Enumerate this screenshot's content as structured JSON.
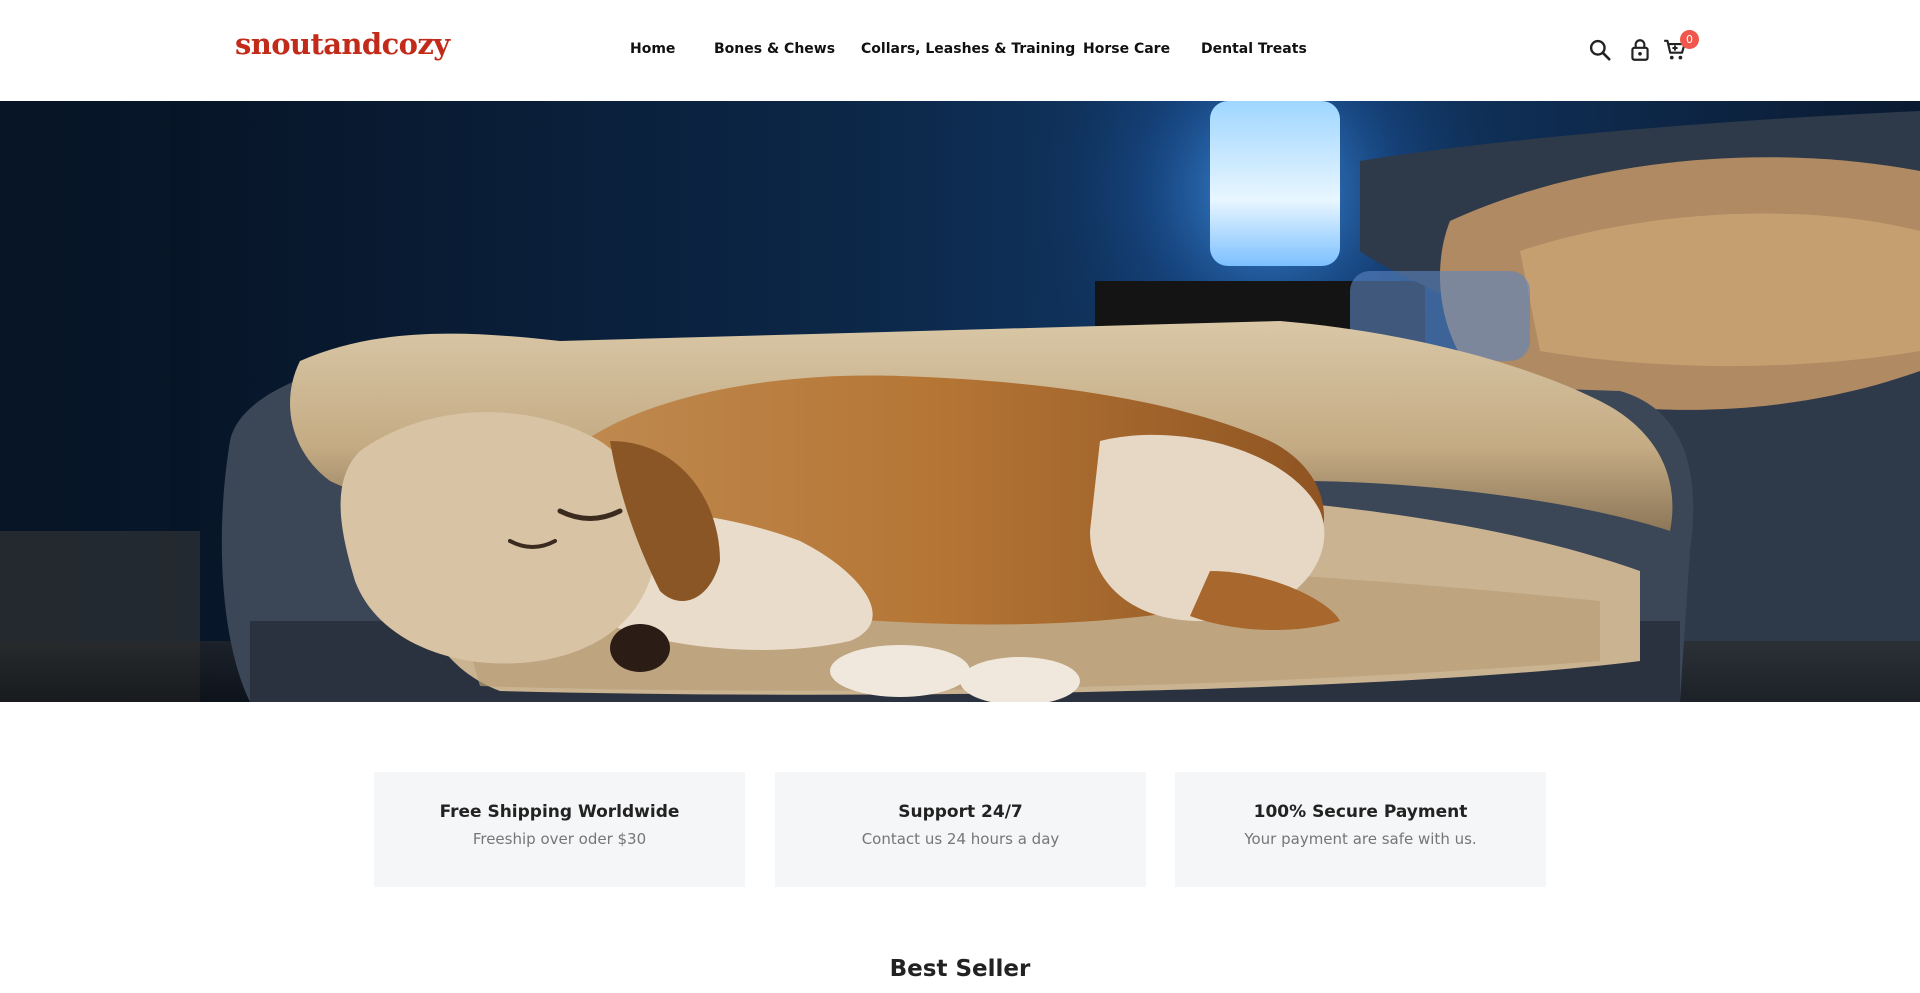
{
  "header": {
    "logo": "snoutandcozy",
    "nav": [
      "Home",
      "Bones & Chews",
      "Collars, Leashes & Training",
      "Horse Care",
      "Dental Treats"
    ],
    "cart_count": "0",
    "icons": [
      "search-icon",
      "lock-icon",
      "cart-icon"
    ]
  },
  "hero": {
    "image": "dog sleeping on plush pet bed at night"
  },
  "features": [
    {
      "title": "Free Shipping Worldwide",
      "subtitle": "Freeship over oder $30"
    },
    {
      "title": "Support 24/7",
      "subtitle": "Contact us 24 hours a day"
    },
    {
      "title": "100% Secure Payment",
      "subtitle": "Your payment are safe with us."
    }
  ],
  "best_seller": {
    "title": "Best Seller"
  },
  "colors": {
    "brand": "#c22a1a",
    "badge": "#f0564b",
    "feature_bg": "#f5f6f7"
  }
}
